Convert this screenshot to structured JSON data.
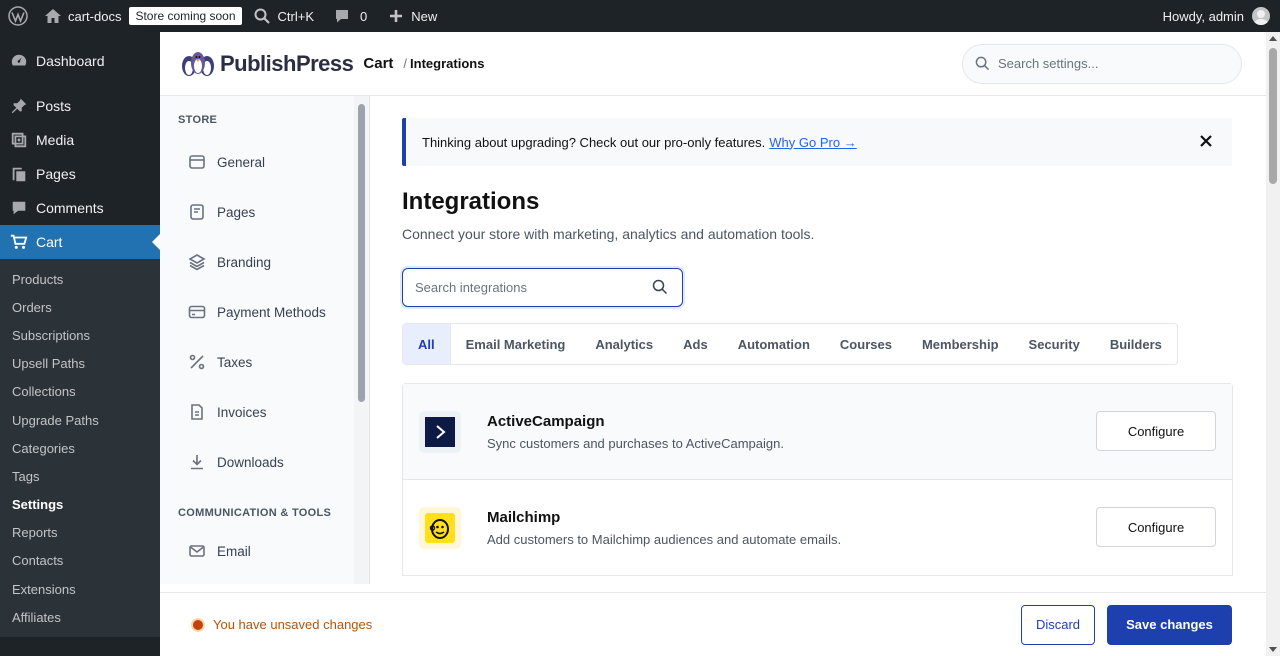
{
  "adminbar": {
    "site_name": "cart-docs",
    "badge": "Store coming soon",
    "shortcut": "Ctrl+K",
    "comments_count": "0",
    "new_label": "New",
    "greeting": "Howdy, admin"
  },
  "wpmenu": {
    "items": [
      {
        "label": "Dashboard",
        "icon": "dashboard-icon"
      },
      {
        "label": "Posts",
        "icon": "pin-icon"
      },
      {
        "label": "Media",
        "icon": "media-icon"
      },
      {
        "label": "Pages",
        "icon": "pages-icon"
      },
      {
        "label": "Comments",
        "icon": "comment-icon"
      },
      {
        "label": "Cart",
        "icon": "cart-icon"
      }
    ],
    "submenu": [
      "Products",
      "Orders",
      "Subscriptions",
      "Upsell Paths",
      "Collections",
      "Upgrade Paths",
      "Categories",
      "Tags",
      "Settings",
      "Reports",
      "Contacts",
      "Extensions",
      "Affiliates"
    ],
    "active_sub": "Settings"
  },
  "header": {
    "logo_text": "PublishPress",
    "product": "Cart",
    "crumb_sep": "/",
    "crumb": "Integrations",
    "search_placeholder": "Search settings..."
  },
  "setnav": {
    "group1": "STORE",
    "items": [
      "General",
      "Pages",
      "Branding",
      "Payment Methods",
      "Taxes",
      "Invoices",
      "Downloads"
    ],
    "group2": "COMMUNICATION & TOOLS",
    "items2": [
      "Email"
    ]
  },
  "notice": {
    "text": "Thinking about upgrading? Check out our pro-only features.",
    "link": "Why Go Pro →"
  },
  "main": {
    "title": "Integrations",
    "subtitle": "Connect your store with marketing, analytics and automation tools.",
    "search_placeholder": "Search integrations",
    "tabs": [
      "All",
      "Email Marketing",
      "Analytics",
      "Ads",
      "Automation",
      "Courses",
      "Membership",
      "Security",
      "Builders"
    ],
    "active_tab": "All",
    "integrations": [
      {
        "name": "ActiveCampaign",
        "desc": "Sync customers and purchases to ActiveCampaign.",
        "button": "Configure"
      },
      {
        "name": "Mailchimp",
        "desc": "Add customers to Mailchimp audiences and automate emails.",
        "button": "Configure"
      }
    ]
  },
  "footer": {
    "unsaved": "You have unsaved changes",
    "discard": "Discard",
    "save": "Save changes"
  },
  "colors": {
    "accent": "#1e40af",
    "wp_blue": "#2271b1",
    "warning": "#b45309"
  }
}
